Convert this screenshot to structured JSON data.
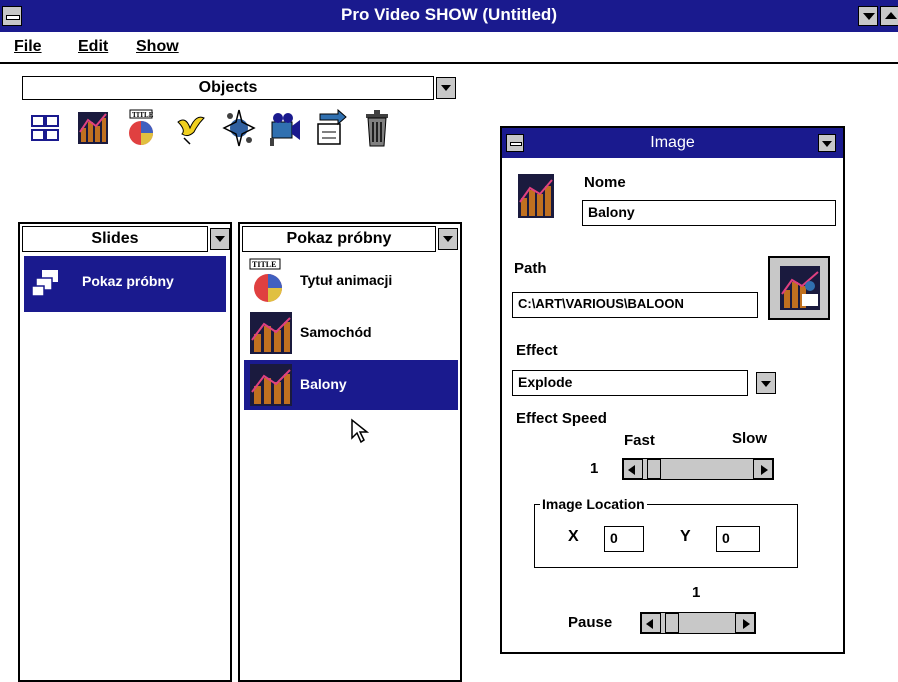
{
  "window": {
    "title": "Pro Video SHOW (Untitled)"
  },
  "menu": {
    "items": [
      "File",
      "Edit",
      "Show"
    ]
  },
  "objects_panel": {
    "title": "Objects",
    "tools": [
      "slides-tool-icon",
      "image-tool-icon",
      "title-tool-icon",
      "bird-animation-icon",
      "sparkle-effect-icon",
      "film-camera-icon",
      "transfer-icon",
      "trash-can-icon"
    ]
  },
  "slides_panel": {
    "title": "Slides",
    "items": [
      {
        "label": "Pokaz próbny",
        "selected": true
      }
    ]
  },
  "show_panel": {
    "title": "Pokaz próbny",
    "items": [
      {
        "label": "Tytuł animacji",
        "icon": "title-chart-icon",
        "badge": "TITLE",
        "selected": false
      },
      {
        "label": "Samochód",
        "icon": "image-icon",
        "selected": false
      },
      {
        "label": "Balony",
        "icon": "image-icon",
        "selected": true
      }
    ]
  },
  "image_dialog": {
    "title": "Image",
    "name_label": "Nome",
    "name_value": "Balony",
    "path_label": "Path",
    "path_value": "C:\\ART\\VARIOUS\\BALOON",
    "effect_label": "Effect",
    "effect_value": "Explode",
    "speed_label": "Effect Speed",
    "speed_fast": "Fast",
    "speed_slow": "Slow",
    "speed_value": "1",
    "location_group": "Image Location",
    "x_label": "X",
    "x_value": "0",
    "y_label": "Y",
    "y_value": "0",
    "pause_value": "1",
    "pause_label": "Pause"
  },
  "colors": {
    "title_bar": "#1a1a8e",
    "selection": "#1a1a8e",
    "button_face": "#c8c8c8"
  }
}
